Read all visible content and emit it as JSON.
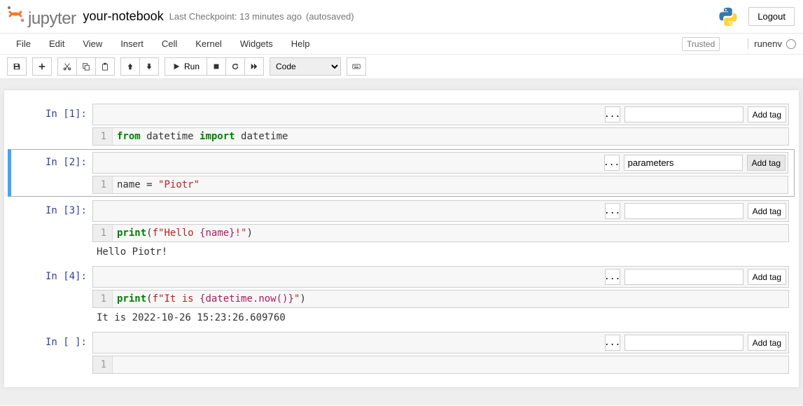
{
  "header": {
    "logo_text": "jupyter",
    "notebook_name": "your-notebook",
    "checkpoint": "Last Checkpoint: 13 minutes ago",
    "autosave": "(autosaved)",
    "logout": "Logout"
  },
  "menubar": {
    "items": [
      "File",
      "Edit",
      "View",
      "Insert",
      "Cell",
      "Kernel",
      "Widgets",
      "Help"
    ],
    "trusted": "Trusted",
    "kernel_name": "runenv"
  },
  "toolbar": {
    "run_label": "Run",
    "cell_type": "Code"
  },
  "tagbar": {
    "ellipsis": "...",
    "add_tag": "Add tag"
  },
  "cells": [
    {
      "prompt": "In [1]:",
      "tag_input": "",
      "gutter": "1",
      "code_tokens": [
        {
          "t": "from",
          "c": "kw-green"
        },
        {
          "t": " datetime ",
          "c": ""
        },
        {
          "t": "import",
          "c": "kw-green"
        },
        {
          "t": " datetime",
          "c": ""
        }
      ],
      "output": ""
    },
    {
      "prompt": "In [2]:",
      "tag_input": "parameters",
      "gutter": "1",
      "selected": true,
      "addtag_active": true,
      "code_tokens": [
        {
          "t": "name ",
          "c": ""
        },
        {
          "t": "=",
          "c": ""
        },
        {
          "t": " ",
          "c": ""
        },
        {
          "t": "\"Piotr\"",
          "c": "str-red"
        }
      ],
      "output": ""
    },
    {
      "prompt": "In [3]:",
      "tag_input": "",
      "gutter": "1",
      "code_tokens": [
        {
          "t": "print",
          "c": "kw-green"
        },
        {
          "t": "(",
          "c": ""
        },
        {
          "t": "f\"Hello ",
          "c": "str-red"
        },
        {
          "t": "{name}",
          "c": "var-pink"
        },
        {
          "t": "!\"",
          "c": "str-red"
        },
        {
          "t": ")",
          "c": ""
        }
      ],
      "output": "Hello Piotr!"
    },
    {
      "prompt": "In [4]:",
      "tag_input": "",
      "gutter": "1",
      "code_tokens": [
        {
          "t": "print",
          "c": "kw-green"
        },
        {
          "t": "(",
          "c": ""
        },
        {
          "t": "f\"It is ",
          "c": "str-red"
        },
        {
          "t": "{datetime.now()}",
          "c": "var-pink"
        },
        {
          "t": "\"",
          "c": "str-red"
        },
        {
          "t": ")",
          "c": ""
        }
      ],
      "output": "It is 2022-10-26 15:23:26.609760"
    },
    {
      "prompt": "In [ ]:",
      "tag_input": "",
      "gutter": "1",
      "code_tokens": [
        {
          "t": " ",
          "c": ""
        }
      ],
      "output": ""
    }
  ]
}
